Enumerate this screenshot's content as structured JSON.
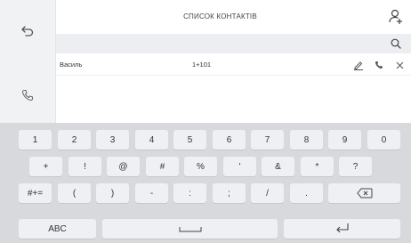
{
  "header": {
    "title": "СПИСОК КОНТАКТІВ"
  },
  "icons": {
    "back": "back-arrow-icon",
    "call": "phone-handset-icon",
    "add_contact": "add-contact-icon",
    "search": "search-icon",
    "edit": "pencil-icon",
    "dial": "phone-icon",
    "delete": "close-icon"
  },
  "contacts": [
    {
      "name": "Василь",
      "number": "1+101"
    }
  ],
  "keyboard": {
    "row1": [
      "1",
      "2",
      "3",
      "4",
      "5",
      "6",
      "7",
      "8",
      "9",
      "0"
    ],
    "row2": [
      "+",
      "!",
      "@",
      "#",
      "%",
      "'",
      "&",
      "*",
      "?"
    ],
    "row3": [
      "#+=",
      "(",
      ")",
      "-",
      ":",
      ";",
      "/",
      "."
    ],
    "row3_backspace_icon": "backspace-icon",
    "row4": {
      "abc": "ABC",
      "space_icon": "space-bar-icon",
      "enter_icon": "enter-return-icon"
    }
  },
  "colors": {
    "sidebar_bg": "#f1f2f4",
    "search_bg": "#eceef1",
    "keyboard_bg": "#d7d9dd",
    "key_bg": "#eef0f3",
    "icon": "#555555"
  }
}
